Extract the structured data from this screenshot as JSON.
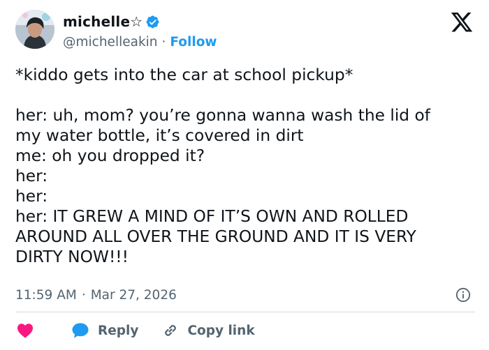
{
  "author": {
    "display_name": "michelle☆",
    "handle": "@michelleakin",
    "separator": "·",
    "follow_label": "Follow"
  },
  "tweet": {
    "lines": [
      "*kiddo gets into the car at school pickup*",
      "",
      "her: uh, mom? you’re gonna wanna wash the lid of",
      "my water bottle, it’s covered in dirt",
      "me: oh you dropped it?",
      "her:",
      "her:",
      "her: IT GREW A MIND OF IT’S OWN AND ROLLED",
      "AROUND ALL OVER THE GROUND AND IT IS VERY",
      "DIRTY NOW!!!"
    ]
  },
  "meta": {
    "time": "11:59 AM",
    "separator": "·",
    "date": "Mar 27, 2026"
  },
  "actions": {
    "reply_label": "Reply",
    "copy_label": "Copy link"
  },
  "colors": {
    "like": "#f91880",
    "verified": "#1d9bf0",
    "follow": "#1d9bf0",
    "secondary_text": "#536471"
  },
  "icons": [
    "avatar-image",
    "verified-badge-icon",
    "x-logo-icon",
    "info-icon",
    "heart-icon",
    "reply-bubble-icon",
    "link-icon"
  ]
}
